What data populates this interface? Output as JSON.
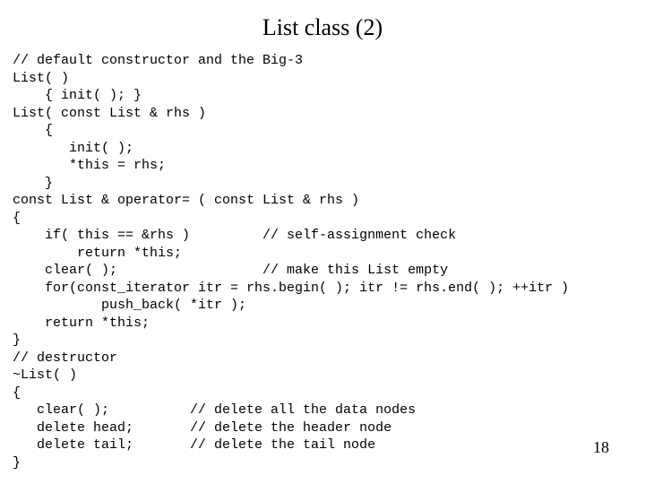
{
  "title": "List class (2)",
  "page_number": "18",
  "code_lines": [
    "// default constructor and the Big-3",
    "List( )",
    "    { init( ); }",
    "List( const List & rhs )",
    "    {",
    "       init( );",
    "       *this = rhs;",
    "    }",
    "const List & operator= ( const List & rhs )",
    "{",
    "    if( this == &rhs )         // self-assignment check",
    "        return *this;",
    "    clear( );                  // make this List empty",
    "    for(const_iterator itr = rhs.begin( ); itr != rhs.end( ); ++itr )",
    "           push_back( *itr );",
    "    return *this;",
    "}",
    "// destructor",
    "~List( )",
    "{",
    "   clear( );          // delete all the data nodes",
    "   delete head;       // delete the header node",
    "   delete tail;       // delete the tail node",
    "}"
  ]
}
